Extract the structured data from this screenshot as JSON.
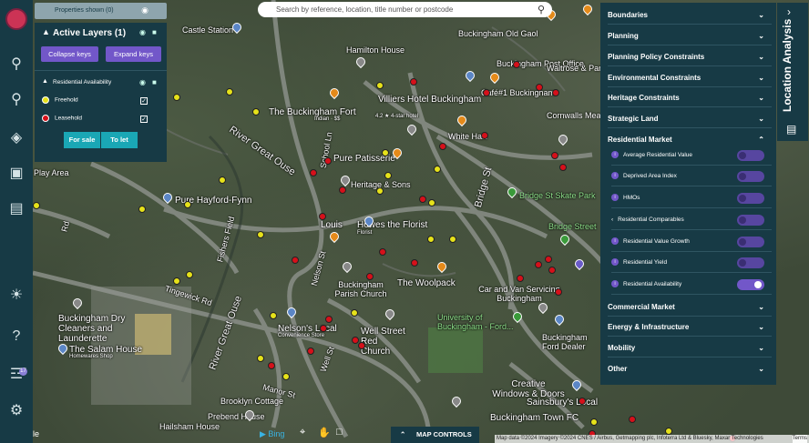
{
  "search": {
    "placeholder": "Search by reference, location, title number or postcode"
  },
  "layers": {
    "properties_shown": "Properties shown (0)",
    "title": "Active Layers (1)",
    "collapse_label": "Collapse keys",
    "expand_label": "Expand keys",
    "group_label": "Residential Availability",
    "items": [
      {
        "label": "Freehold",
        "color": "#e6e21a",
        "checked": true
      },
      {
        "label": "Leasehold",
        "color": "#d6101a",
        "checked": true
      }
    ],
    "for_sale": "For sale",
    "to_let": "To let"
  },
  "right_panel": {
    "sections": [
      "Boundaries",
      "Planning",
      "Planning Policy Constraints",
      "Environmental Constraints",
      "Heritage Constraints",
      "Strategic Land",
      "Residential Market"
    ],
    "residential_items": [
      {
        "label": "Average Residential Value",
        "on": false
      },
      {
        "label": "Deprived Area Index",
        "on": false
      },
      {
        "label": "HMOs",
        "on": false
      },
      {
        "label": "Residential Comparables",
        "on": false
      },
      {
        "label": "Residential Value Growth",
        "on": false
      },
      {
        "label": "Residential Yield",
        "on": false
      },
      {
        "label": "Residential Availability",
        "on": true
      }
    ],
    "bottom_sections": [
      "Commercial Market",
      "Energy & Infrastructure",
      "Mobility",
      "Other"
    ]
  },
  "location_analysis": "Location Analysis",
  "map_controls": "MAP CONTROLS",
  "attribution": "Map data ©2024 Imagery ©2024 CNES / Airbus, Getmapping plc, Infoterra Ltd & Bluesky, Maxar Technologies",
  "terms": "Terms",
  "bing": "Bing",
  "map_labels": [
    "Buckingham Old Gaol",
    "Hamilton House",
    "Buckingham Post Office",
    "Waitrose & Partners Buckingham",
    "Café#1 Buckingham",
    "Villiers Hotel Buckingham",
    "Cornwalls Meadow Car Park",
    "The Buckingham Fort",
    "Indian · $$",
    "4.2 ★ 4-star hotel",
    "White Hart",
    "Pure Patisserie",
    "Heritage & Sons",
    "Bridge St Skate Park",
    "Bridge Street",
    "Pure Hayford-Fynn",
    "Howes the Florist",
    "Florist",
    "Louis",
    "The Woolpack",
    "Car and Van Servicing Buckingham",
    "Buckingham Parish Church",
    "Nelson's Local",
    "Convenience Store",
    "Well Street Red Church",
    "University of Buckingham - Ford...",
    "Bridge St",
    "Buckingham Dry Cleaners and Launderette",
    "The Salam House",
    "Homewares Shop",
    "Creative Windows & Doors",
    "Sainsbury's Local",
    "Brooklyn Cottage",
    "Prebend House",
    "Hailsham House",
    "Buckingham Town FC",
    "Castle Station",
    "Play Area",
    "River Great Ouse",
    "Tingewick Rd",
    "Nelson St",
    "Well St",
    "Manor St",
    "School Ln",
    "Fishers Field",
    "Rd",
    "Buckingham Ford Dealer"
  ]
}
